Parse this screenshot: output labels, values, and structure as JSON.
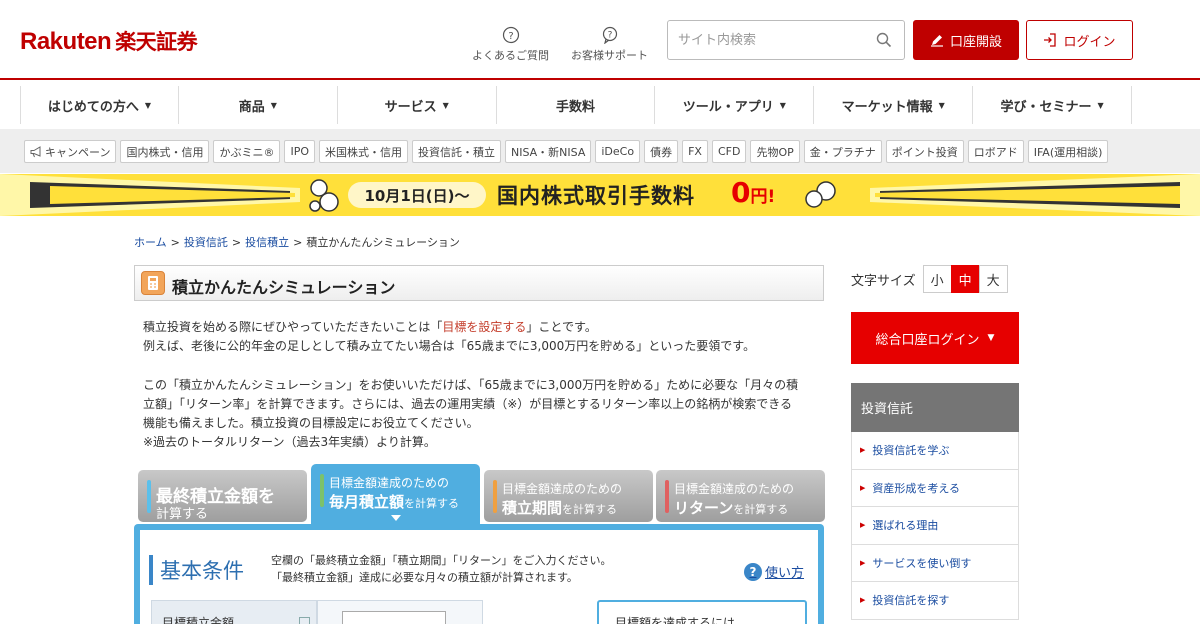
{
  "header": {
    "logo_en": "Rakuten",
    "logo_jp": "楽天証券",
    "faq_label": "よくあるご質問",
    "support_label": "お客様サポート",
    "search_placeholder": "サイト内検索",
    "open_account_label": "口座開設",
    "login_label": "ログイン",
    "brand_color": "#bf0000"
  },
  "global_nav": [
    {
      "label": "はじめての方へ",
      "caret": "▼"
    },
    {
      "label": "商品",
      "caret": "▼"
    },
    {
      "label": "サービス",
      "caret": "▼"
    },
    {
      "label": "手数料",
      "caret": ""
    },
    {
      "label": "ツール・アプリ",
      "caret": "▼"
    },
    {
      "label": "マーケット情報",
      "caret": "▼"
    },
    {
      "label": "学び・セミナー",
      "caret": "▼"
    }
  ],
  "sub_nav": [
    "キャンペーン",
    "国内株式・信用",
    "かぶミニ®",
    "IPO",
    "米国株式・信用",
    "投資信託・積立",
    "NISA・新NISA",
    "iDeCo",
    "債券",
    "FX",
    "CFD",
    "先物OP",
    "金・プラチナ",
    "ポイント投資",
    "ロボアド",
    "IFA(運用相談)"
  ],
  "banner": {
    "date": "10月1日(日)〜",
    "text": "国内株式取引手数料",
    "zero": "0",
    "yen": "円!"
  },
  "breadcrumb": [
    {
      "label": "ホーム",
      "link": true
    },
    {
      "label": "投資信託",
      "link": true
    },
    {
      "label": "投信積立",
      "link": true
    },
    {
      "label": "積立かんたんシミュレーション",
      "link": false
    }
  ],
  "breadcrumb_sep": ">",
  "page_title": "積立かんたんシミュレーション",
  "intro": {
    "l1a": "積立投資を始める際にぜひやっていただきたいことは「",
    "l1b": "目標を設定する",
    "l1c": "」ことです。",
    "l2": "例えば、老後に公的年金の足しとして積み立てたい場合は「65歳までに3,000万円を貯める」といった要領です。",
    "l3": "この「積立かんたんシミュレーション」をお使いいただけば、「65歳までに3,000万円を貯める」ために必要な「月々の積",
    "l4": "立額」「リターン率」を計算できます。さらには、過去の運用実績（※）が目標とするリターン率以上の銘柄が検索できる",
    "l5": "機能も備えました。積立投資の目標設定にお役立てください。",
    "l6": "※過去のトータルリターン（過去3年実績）より計算。"
  },
  "tabs": [
    {
      "line1": "最終積立金額を",
      "line2": "計算する",
      "bar_color": "#5bc0eb",
      "active": false
    },
    {
      "line1": "目標金額達成のための",
      "line2": "毎月積立額",
      "suffix": "を計算する",
      "bar_color": "#7cc26b",
      "active": true
    },
    {
      "line1": "目標金額達成のための",
      "line2": "積立期間",
      "suffix": "を計算する",
      "bar_color": "#f0a040",
      "active": false
    },
    {
      "line1": "目標金額達成のための",
      "line2": "リターン",
      "suffix": "を計算する",
      "bar_color": "#e06060",
      "active": false
    }
  ],
  "panel": {
    "heading": "基本条件",
    "desc1": "空欄の「最終積立金額」「積立期間」「リターン」をご入力ください。",
    "desc2": "「最終積立金額」達成に必要な月々の積立額が計算されます。",
    "help_label": "使い方",
    "field_label": "目標積立金額",
    "result_label": "目標額を達成するには"
  },
  "font_size": {
    "label": "文字サイズ",
    "options": [
      "小",
      "中",
      "大"
    ],
    "selected": "中"
  },
  "account_login": {
    "label": "総合口座ログイン",
    "caret": "▼"
  },
  "sidebar": {
    "header": "投資信託",
    "items": [
      "投資信託を学ぶ",
      "資産形成を考える",
      "選ばれる理由",
      "サービスを使い倒す",
      "投資信託を探す"
    ]
  }
}
